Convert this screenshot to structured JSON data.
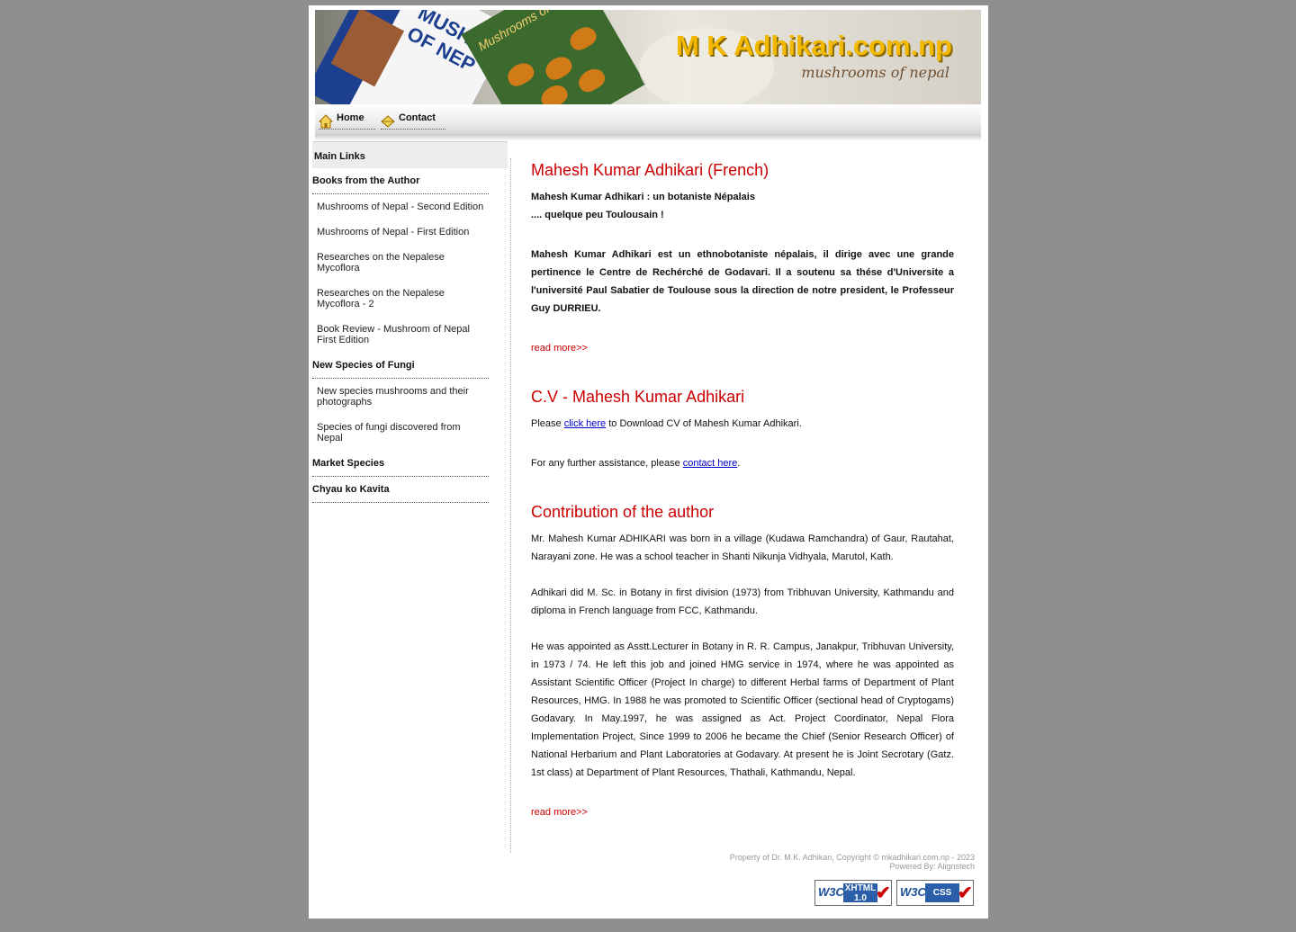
{
  "header": {
    "site_title": "M K Adhikari.com.np",
    "site_subtitle": "mushrooms of nepal"
  },
  "nav": {
    "items": [
      {
        "label": "Home",
        "icon": "home-icon"
      },
      {
        "label": "Contact",
        "icon": "envelope-icon"
      }
    ]
  },
  "sidebar": {
    "title": "Main Links",
    "categories": [
      {
        "label": "Books from the Author",
        "items": [
          "Mushrooms of Nepal - Second Edition",
          "Mushrooms of Nepal - First Edition",
          "Researches on the Nepalese Mycoflora",
          "Researches on the Nepalese Mycoflora - 2",
          "Book Review - Mushroom of Nepal First Edition"
        ]
      },
      {
        "label": "New Species of Fungi",
        "items": [
          "New species mushrooms and their photographs",
          "Species of fungi discovered from Nepal"
        ]
      },
      {
        "label": "Market Species",
        "items": []
      },
      {
        "label": "Chyau ko Kavita",
        "items": []
      }
    ]
  },
  "main": {
    "section1": {
      "title": "Mahesh Kumar Adhikari (French)",
      "line1": "Mahesh Kumar Adhikari : un botaniste Népalais",
      "line2": ".... quelque peu Toulousain  !",
      "body": "Mahesh Kumar Adhikari est un ethnobotaniste népalais, il dirige avec une grande pertinence le Centre de Rechérché de Godavari. Il a soutenu sa thése d'Universite a l'université Paul Sabatier de Toulouse sous la direction de notre president, le Professeur Guy DURRIEU.",
      "read_more": "read more>>"
    },
    "section2": {
      "title": "C.V - Mahesh Kumar Adhikari",
      "cv_prefix": "Please ",
      "cv_link": "click here",
      "cv_suffix": " to Download CV of Mahesh Kumar Adhikari.",
      "assist_prefix": "For any further assistance, please ",
      "assist_link": "contact here",
      "assist_suffix": "."
    },
    "section3": {
      "title": "Contribution of the author",
      "p1": "Mr. Mahesh Kumar ADHIKARI was born in a village (Kudawa Ramchandra) of Gaur, Rautahat, Narayani zone. He was a school teacher in Shanti Nikunja Vidhyala, Marutol, Kath.",
      "p2": "Adhikari did M. Sc. in Botany in first division (1973) from Tribhuvan University, Kathmandu and diploma in French language from FCC, Kathmandu.",
      "p3": "He was appointed as Asstt.Lecturer in Botany in R. R. Campus, Janakpur, Tribhuvan University, in 1973 / 74.  He left this job and joined HMG service in 1974, where he was appointed as Assistant Scientific Officer (Project In charge) to different Herbal farms of Department of Plant Resources, HMG. In 1988 he was promoted to Scientific Officer (sectional head of Cryptogams) Godavary. In May.1997, he was assigned as Act. Project Coordinator, Nepal Flora Implementation Project, Since 1999 to 2006 he became the Chief (Senior Research Officer) of National Herbarium and Plant Laboratories at Godavary. At present he is Joint Secrotary (Gatz. 1st class) at Department of Plant Resources, Thathali, Kathmandu, Nepal.",
      "read_more": "read more>>"
    }
  },
  "footer": {
    "copyright": "Property of Dr. M.K. Adhikari, Copyright © mkadhikari.com.np - 2023",
    "powered_prefix": "Powered By: ",
    "powered_link": "Alignstech",
    "badge_xhtml": "XHTML 1.0",
    "badge_css": "CSS",
    "badge_w3c": "W3C"
  }
}
